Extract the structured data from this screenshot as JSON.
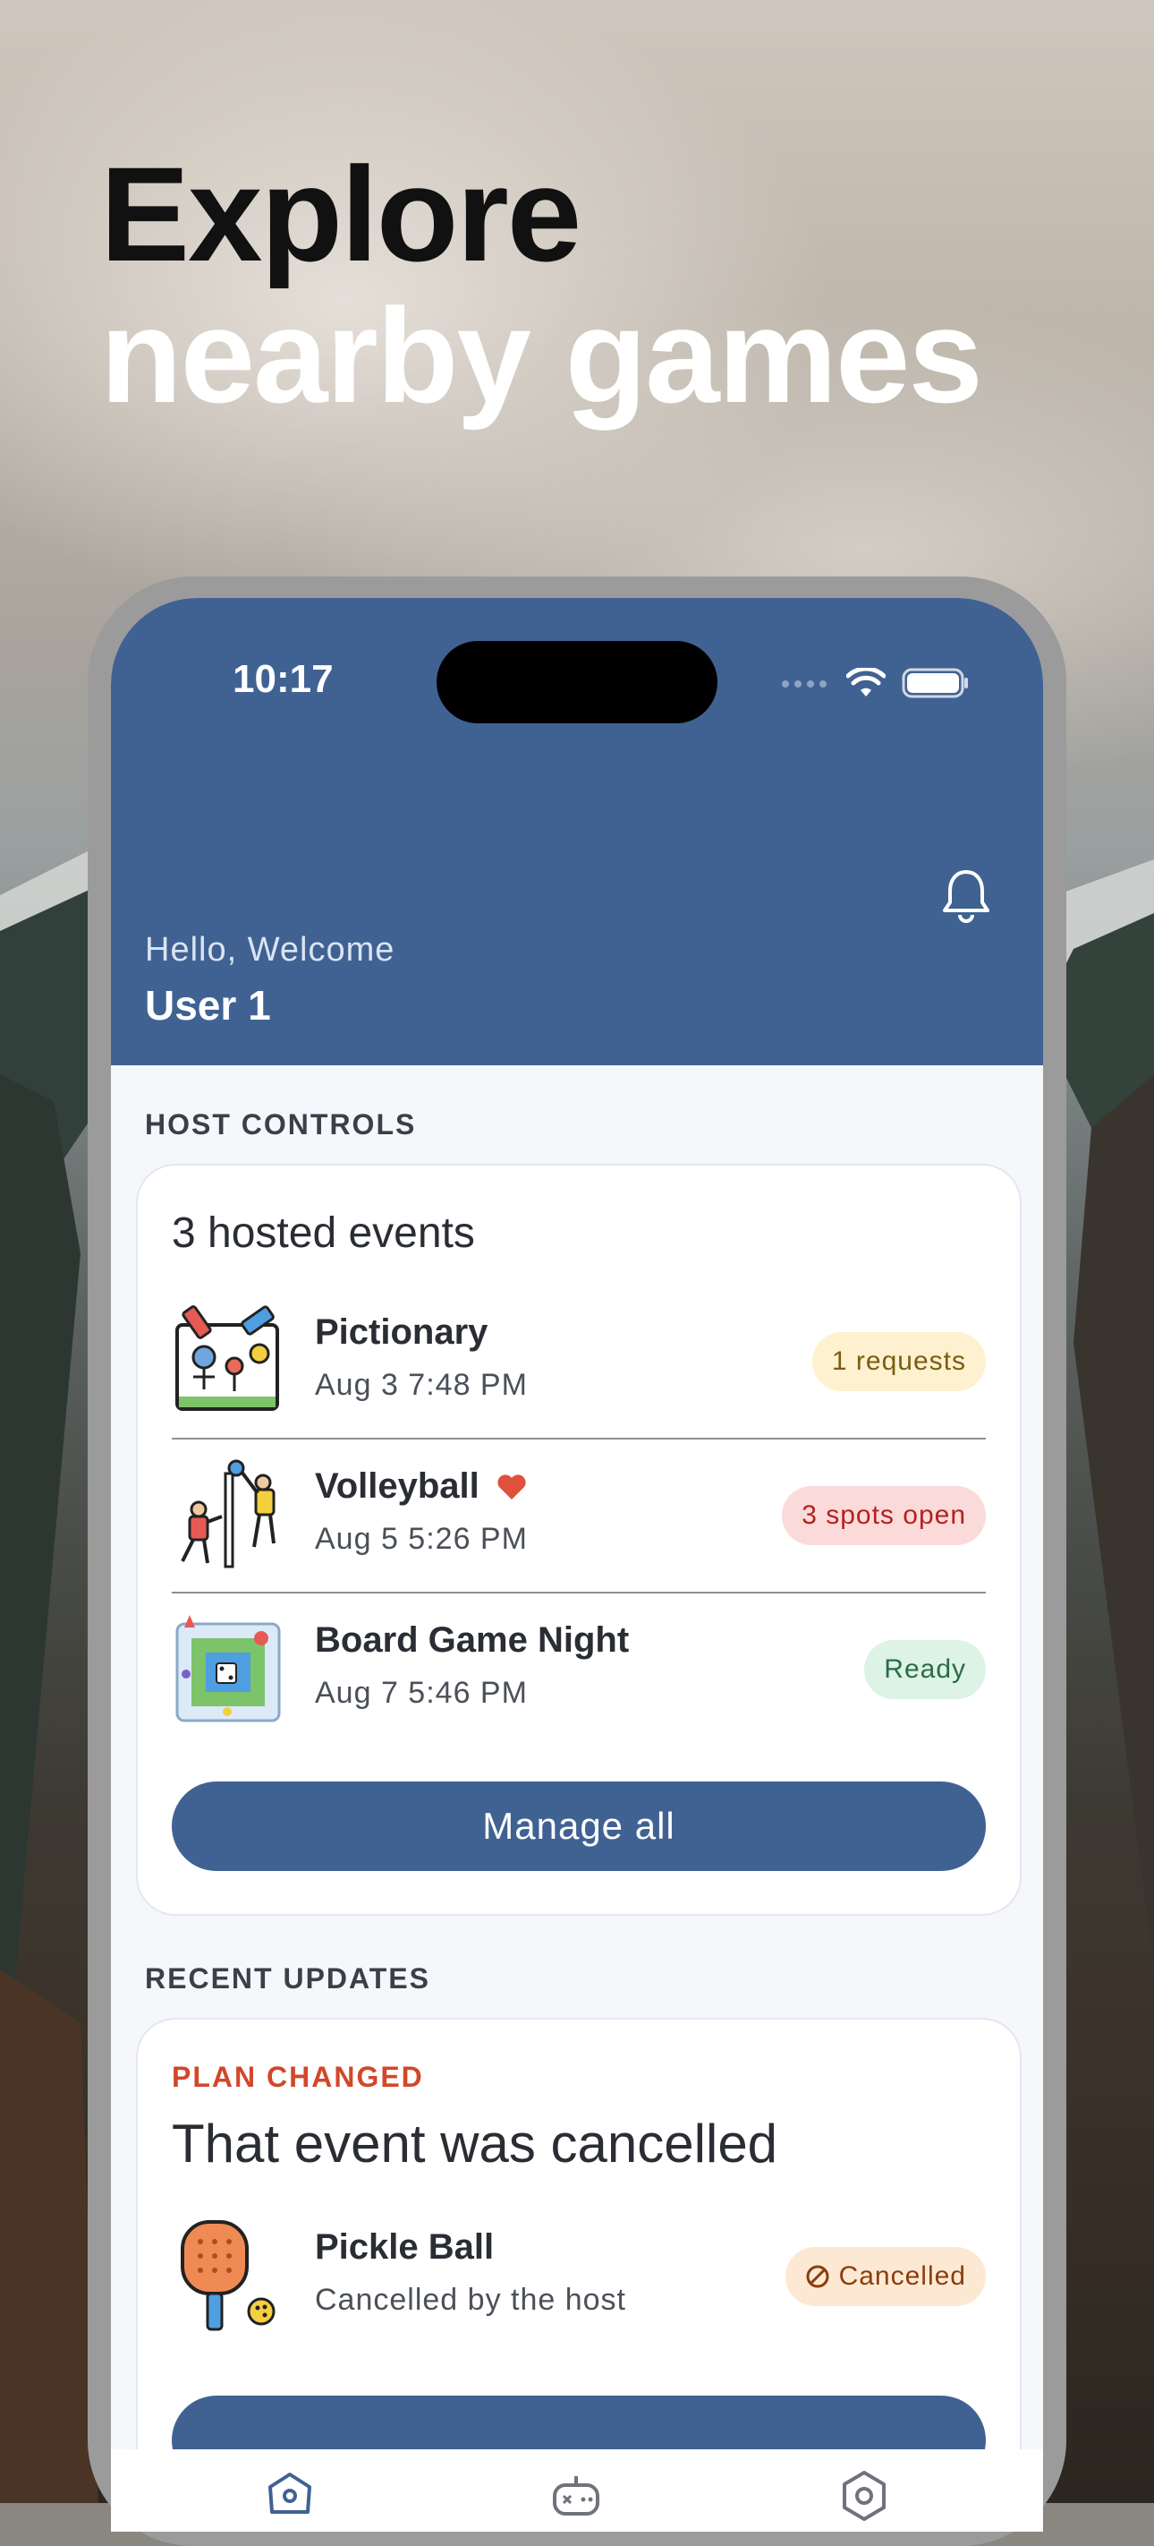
{
  "headline": {
    "line1": "Explore",
    "line2": "nearby games"
  },
  "status_bar": {
    "time": "10:17"
  },
  "header": {
    "greeting": "Hello, Welcome",
    "user_name": "User 1"
  },
  "host_controls": {
    "section_label": "HOST CONTROLS",
    "card_title": "3 hosted events",
    "events": [
      {
        "name": "Pictionary",
        "when": "Aug 3 7:48 PM",
        "badge": "1 requests",
        "badge_color": "#fdf1cf",
        "icon": "pictionary-icon"
      },
      {
        "name": "Volleyball",
        "when": "Aug 5 5:26 PM",
        "badge": "3 spots open",
        "badge_color": "#fbdada",
        "icon": "volleyball-icon",
        "favorited": true
      },
      {
        "name": "Board Game Night",
        "when": "Aug 7 5:46 PM",
        "badge": "Ready",
        "badge_color": "#dcf3e6",
        "icon": "board-game-icon"
      }
    ],
    "manage_button": "Manage all"
  },
  "recent_updates": {
    "section_label": "RECENT UPDATES",
    "kicker": "PLAN CHANGED",
    "title": "That event was cancelled",
    "item": {
      "name": "Pickle Ball",
      "detail": "Cancelled by the host",
      "badge": "Cancelled",
      "icon": "pickleball-icon"
    }
  },
  "tabbar": {
    "tabs": [
      "home-tab-icon",
      "games-tab-icon",
      "settings-tab-icon"
    ]
  },
  "colors": {
    "primary": "#406293",
    "accent_red": "#d2472a",
    "heart": "#e0503a"
  }
}
